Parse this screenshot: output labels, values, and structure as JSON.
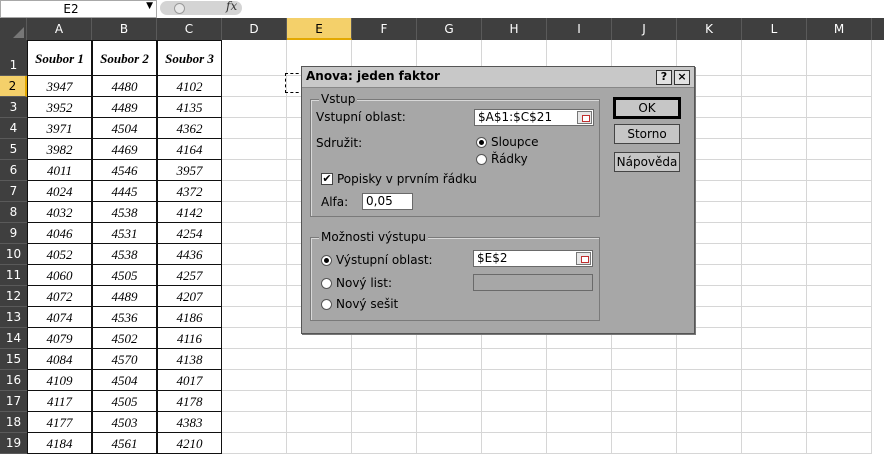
{
  "formula_bar": {
    "name_box": "E2",
    "fx": "fx"
  },
  "grid": {
    "columns": [
      "A",
      "B",
      "C",
      "D",
      "E",
      "F",
      "G",
      "H",
      "I",
      "J",
      "K",
      "L",
      "M"
    ],
    "selected_column": "E",
    "rows": [
      "1",
      "2",
      "3",
      "4",
      "5",
      "6",
      "7",
      "8",
      "9",
      "10",
      "11",
      "12",
      "13",
      "14",
      "15",
      "16",
      "17",
      "18",
      "19"
    ],
    "selected_row": "2",
    "header_row": [
      "Soubor 1",
      "Soubor 2",
      "Soubor 3"
    ],
    "data": [
      [
        "3947",
        "4480",
        "4102"
      ],
      [
        "3952",
        "4489",
        "4135"
      ],
      [
        "3971",
        "4504",
        "4362"
      ],
      [
        "3982",
        "4469",
        "4164"
      ],
      [
        "4011",
        "4546",
        "3957"
      ],
      [
        "4024",
        "4445",
        "4372"
      ],
      [
        "4032",
        "4538",
        "4142"
      ],
      [
        "4046",
        "4531",
        "4254"
      ],
      [
        "4052",
        "4538",
        "4436"
      ],
      [
        "4060",
        "4505",
        "4257"
      ],
      [
        "4072",
        "4489",
        "4207"
      ],
      [
        "4074",
        "4536",
        "4186"
      ],
      [
        "4079",
        "4502",
        "4116"
      ],
      [
        "4084",
        "4570",
        "4138"
      ],
      [
        "4109",
        "4504",
        "4017"
      ],
      [
        "4117",
        "4505",
        "4178"
      ],
      [
        "4177",
        "4503",
        "4383"
      ],
      [
        "4184",
        "4561",
        "4210"
      ]
    ]
  },
  "dialog": {
    "title": "Anova: jeden faktor",
    "help_btn": "?",
    "close_btn": "×",
    "input_group": "Vstup",
    "input_range_label": "Vstupní oblast:",
    "input_range_value": "$A$1:$C$21",
    "group_by_label": "Sdružit:",
    "columns_option": "Sloupce",
    "rows_option": "Řádky",
    "labels_checkbox": "Popisky v prvním řádku",
    "labels_checked": "✔",
    "alpha_label": "Alfa:",
    "alpha_value": "0,05",
    "output_group": "Možnosti výstupu",
    "output_range_label": "Výstupní oblast:",
    "output_range_value": "$E$2",
    "new_sheet_label": "Nový list:",
    "new_workbook_label": "Nový sešit",
    "ok_button": "OK",
    "cancel_button": "Storno",
    "help_button": "Nápověda"
  }
}
